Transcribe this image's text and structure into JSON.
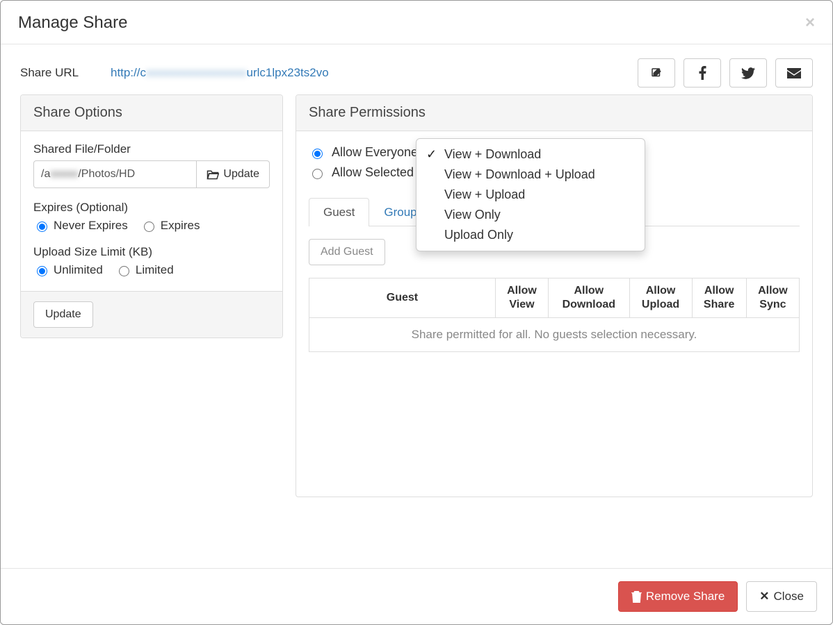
{
  "header": {
    "title": "Manage Share"
  },
  "share_url": {
    "label": "Share URL",
    "prefix": "http://c",
    "obscured": "xxxxxxxxxxxxxxxxx",
    "suffix": "urlc1lpx23ts2vo"
  },
  "share_options": {
    "heading": "Share Options",
    "shared_file_label": "Shared File/Folder",
    "path_prefix": "/a",
    "path_obscured": "xxxxx",
    "path_suffix": "/Photos/HD",
    "update_path_btn": "Update",
    "expires_label": "Expires (Optional)",
    "expires_never": "Never Expires",
    "expires_yes": "Expires",
    "expires_selected": "never",
    "upload_limit_label": "Upload Size Limit (KB)",
    "upload_unlimited": "Unlimited",
    "upload_limited": "Limited",
    "upload_selected": "unlimited",
    "footer_update_btn": "Update"
  },
  "share_permissions": {
    "heading": "Share Permissions",
    "allow_everyone": "Allow Everyone",
    "allow_selected": "Allow Selected U",
    "scope_selected": "everyone",
    "tabs": {
      "guest": "Guest",
      "group": "Group",
      "active": "guest"
    },
    "add_guest_btn": "Add Guest",
    "table": {
      "cols": {
        "guest": "Guest",
        "allow_view": "Allow View",
        "allow_download": "Allow Download",
        "allow_upload": "Allow Upload",
        "allow_share": "Allow Share",
        "allow_sync": "Allow Sync"
      },
      "empty_message": "Share permitted for all. No guests selection necessary."
    },
    "dropdown": {
      "selected": "View + Download",
      "options": [
        "View + Download",
        "View + Download + Upload",
        "View + Upload",
        "View Only",
        "Upload Only"
      ]
    }
  },
  "footer": {
    "remove_share": "Remove Share",
    "close": "Close"
  },
  "icons": {
    "edit": "edit-icon",
    "facebook": "facebook-icon",
    "twitter": "twitter-icon",
    "email": "envelope-icon",
    "folder": "folder-open-icon",
    "trash": "trash-icon",
    "close_x": "close-icon"
  }
}
